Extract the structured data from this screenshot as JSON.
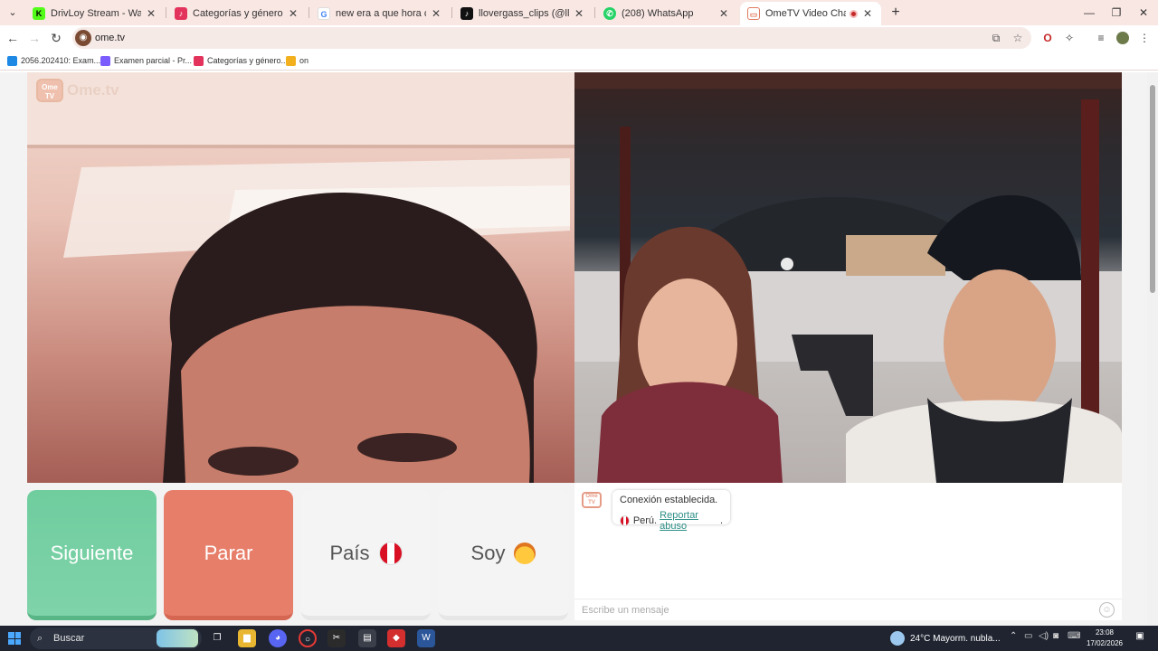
{
  "tabs": [
    {
      "title": "DrivLoy Stream - Watch Live on",
      "icon": "kick-icon",
      "color": "#53fc18"
    },
    {
      "title": "Categorías y géneros musicales",
      "icon": "music-icon",
      "color": "#e3335c"
    },
    {
      "title": "new era a que hora cierra - Bus",
      "icon": "google-icon",
      "color": "#4285f4"
    },
    {
      "title": "llovergass_clips (@llovergass_cl",
      "icon": "tiktok-icon",
      "color": "#111111"
    },
    {
      "title": "(208) WhatsApp",
      "icon": "whatsapp-icon",
      "color": "#25d366"
    },
    {
      "title": "OmeTV Video Chat — Ome",
      "icon": "ometv-icon",
      "color": "#e07a5f",
      "active": true
    }
  ],
  "browser": {
    "url": "ome.tv"
  },
  "bookmarks": [
    {
      "label": "2056.202410: Exam...",
      "color": "#1e88e5"
    },
    {
      "label": "Examen parcial - Pr...",
      "color": "#7b5cff"
    },
    {
      "label": "Categorías y género...",
      "color": "#e3335c"
    },
    {
      "label": "on",
      "color": "#f2b01e"
    }
  ],
  "ometv": {
    "logo_text": "Ome.tv",
    "logo_badge": "Ome TV",
    "buttons": {
      "next": "Siguiente",
      "stop": "Parar",
      "country": "País",
      "soy": "Soy"
    },
    "chat": {
      "message_line1": "Conexión establecida.",
      "country": "Perú.",
      "report_link": "Reportar abuso",
      "report_suffix": ".",
      "input_placeholder": "Escribe un mensaje"
    }
  },
  "taskbar": {
    "search_label": "Buscar",
    "weather": "24°C  Mayorm. nubla...",
    "time": "23:08",
    "date": "17/02/2026"
  }
}
